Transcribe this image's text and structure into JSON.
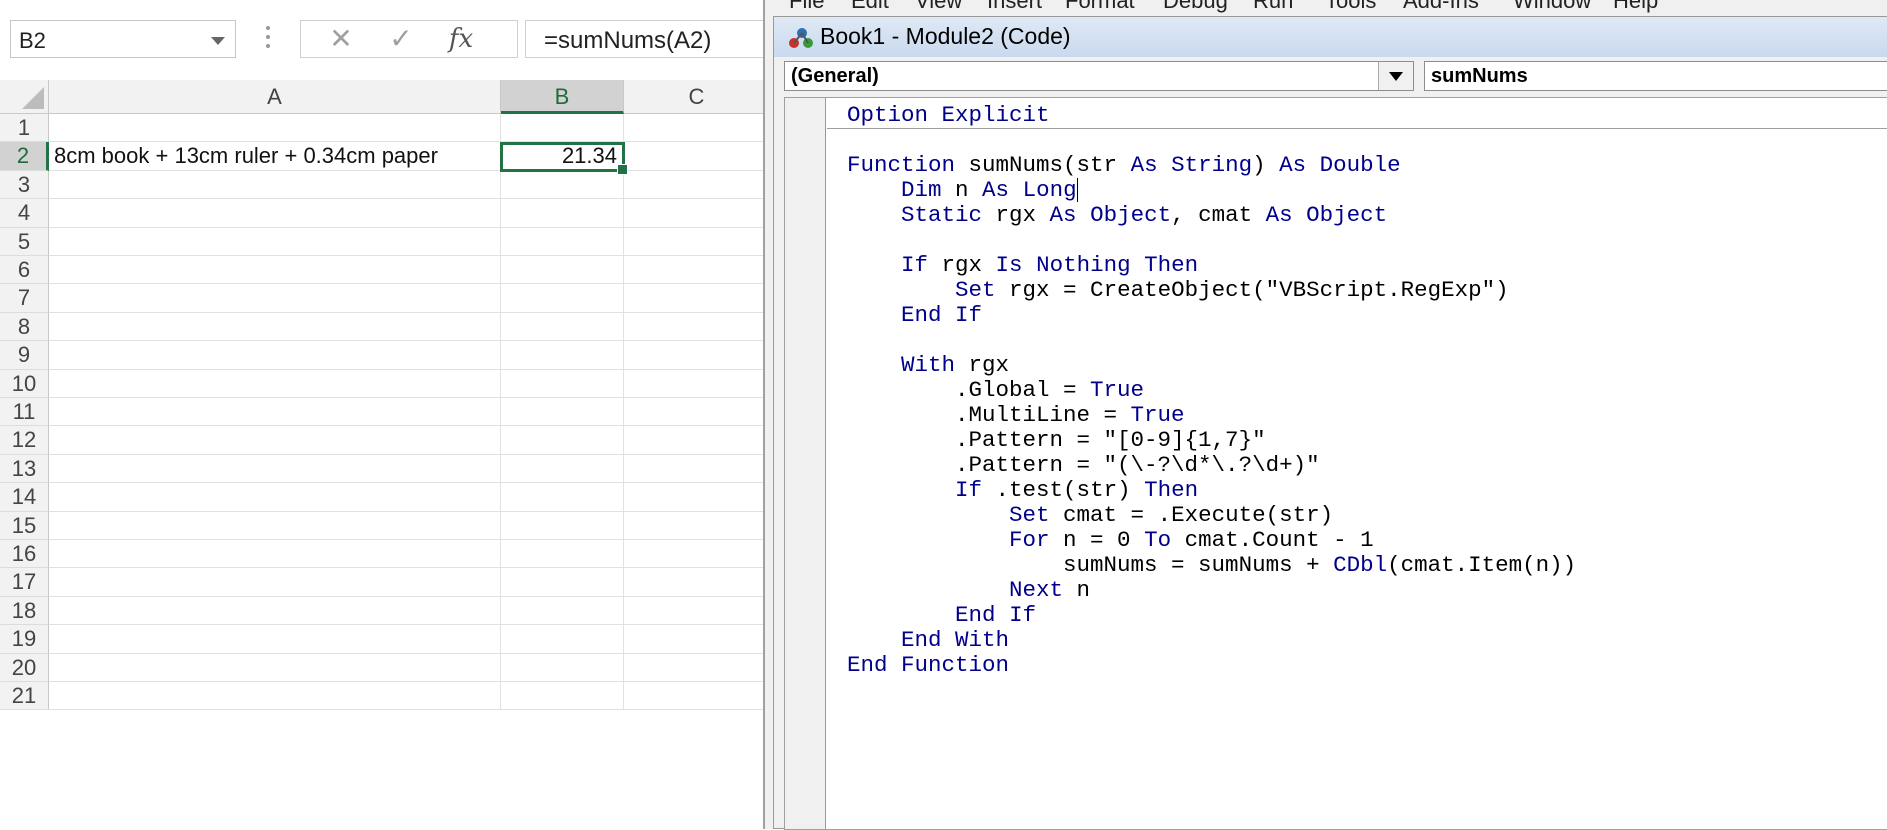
{
  "excel": {
    "name_box": "B2",
    "formula_buttons": {
      "cancel": "✕",
      "enter": "✓",
      "fx": "fx"
    },
    "formula": "=sumNums(A2)",
    "columns": [
      "A",
      "B",
      "C"
    ],
    "rows": [
      "1",
      "2",
      "3",
      "4",
      "5",
      "6",
      "7",
      "8",
      "9",
      "10",
      "11",
      "12",
      "13",
      "14",
      "15",
      "16",
      "17",
      "18",
      "19",
      "20",
      "21"
    ],
    "cells": {
      "A2": "8cm book + 13cm ruler + 0.34cm paper",
      "B2": "21.34"
    }
  },
  "vbe": {
    "menu": [
      "File",
      "Edit",
      "View",
      "Insert",
      "Format",
      "Debug",
      "Run",
      "Tools",
      "Add-Ins",
      "Window",
      "Help"
    ],
    "window_title": "Book1 - Module2 (Code)",
    "object_combo": "(General)",
    "procedure_combo": "sumNums",
    "code_lines": [
      "Option Explicit",
      "",
      "Function sumNums(str As String) As Double",
      "    Dim n As Long",
      "    Static rgx As Object, cmat As Object",
      "",
      "    If rgx Is Nothing Then",
      "        Set rgx = CreateObject(\"VBScript.RegExp\")",
      "    End If",
      "",
      "    With rgx",
      "        .Global = True",
      "        .MultiLine = True",
      "        .Pattern = \"[0-9]{1,7}\"",
      "        .Pattern = \"(\\-?\\d*\\.?\\d+)\"",
      "        If .test(str) Then",
      "            Set cmat = .Execute(str)",
      "            For n = 0 To cmat.Count - 1",
      "                sumNums = sumNums + CDbl(cmat.Item(n))",
      "            Next n",
      "        End If",
      "    End With",
      "End Function"
    ],
    "colors": {
      "keyword": "#00008b",
      "excel_accent": "#217346"
    }
  }
}
